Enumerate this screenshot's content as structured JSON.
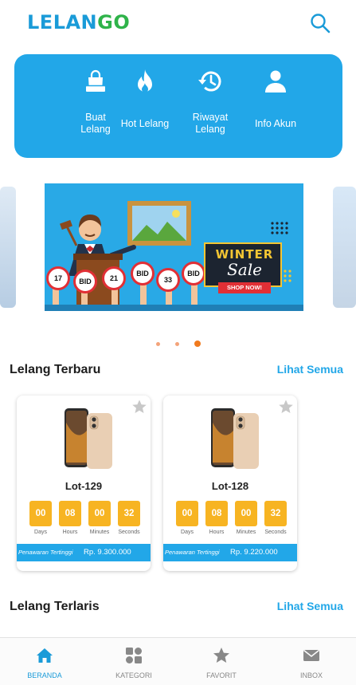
{
  "app": {
    "logo_text": "LELAN",
    "logo_suffix": "GO"
  },
  "colors": {
    "primary": "#22a7e8",
    "logo_blue": "#1a9bd8",
    "logo_green": "#2fb34a",
    "timer": "#f7b422",
    "dot_active": "#f07a1e"
  },
  "menu": [
    {
      "icon": "shopping-bag-icon",
      "label": "Buat\nLelang"
    },
    {
      "icon": "flame-icon",
      "label": "Hot Lelang"
    },
    {
      "icon": "history-icon",
      "label": "Riwayat\nLelang"
    },
    {
      "icon": "user-icon",
      "label": "Info Akun"
    }
  ],
  "banner": {
    "headline": "WINTER",
    "subheadline": "Sale",
    "cta": "SHOP NOW!",
    "signs": [
      "17",
      "BID",
      "21",
      "BID",
      "33",
      "BID"
    ],
    "active_slide": 3,
    "slide_count": 3
  },
  "sections": {
    "latest": {
      "title": "Lelang Terbaru",
      "see_all": "Lihat Semua"
    },
    "best": {
      "title": "Lelang Terlaris",
      "see_all": "Lihat Semua"
    }
  },
  "timer_labels": [
    "Days",
    "Hours",
    "Minutes",
    "Seconds"
  ],
  "products": [
    {
      "lot": "Lot-129",
      "timer": [
        "00",
        "08",
        "00",
        "32"
      ],
      "bid_label": "Penawaran Tertinggi",
      "bid_price": "Rp. 9.300.000"
    },
    {
      "lot": "Lot-128",
      "timer": [
        "00",
        "08",
        "00",
        "32"
      ],
      "bid_label": "Penawaran Tertinggi",
      "bid_price": "Rp. 9.220.000"
    }
  ],
  "nav": [
    {
      "icon": "home-icon",
      "label": "BERANDA",
      "active": true
    },
    {
      "icon": "category-icon",
      "label": "KATEGORI",
      "active": false
    },
    {
      "icon": "star-icon",
      "label": "FAVORIT",
      "active": false
    },
    {
      "icon": "mail-icon",
      "label": "INBOX",
      "active": false
    }
  ]
}
